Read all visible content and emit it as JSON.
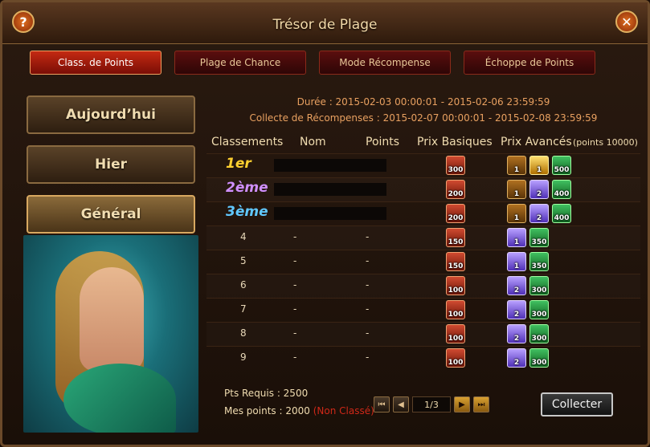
{
  "window": {
    "title": "Trésor de Plage"
  },
  "tabs": [
    {
      "label": "Class. de Points",
      "active": true
    },
    {
      "label": "Plage de Chance",
      "active": false
    },
    {
      "label": "Mode Récompense",
      "active": false
    },
    {
      "label": "Échoppe de Points",
      "active": false
    }
  ],
  "sidebar": {
    "buttons": [
      {
        "label": "Aujourd’hui",
        "active": false
      },
      {
        "label": "Hier",
        "active": false
      },
      {
        "label": "Général",
        "active": true
      }
    ]
  },
  "info": {
    "duration": "Durée : 2015-02-03 00:00:01 - 2015-02-06 23:59:59",
    "collect": "Collecte de Récompenses : 2015-02-07 00:00:01 - 2015-02-08 23:59:59"
  },
  "table": {
    "headers": {
      "rank": "Classements",
      "name": "Nom",
      "points": "Points",
      "basic": "Prix Basiques",
      "advanced": "Prix Avancés",
      "adv_note": "(points 10000)"
    },
    "rows": [
      {
        "rank": "1er",
        "name": "",
        "points": "",
        "basic": "300",
        "adv": [
          {
            "type": "chest",
            "qty": "1"
          },
          {
            "type": "gold",
            "qty": "1"
          },
          {
            "type": "green",
            "qty": "500"
          }
        ]
      },
      {
        "rank": "2ème",
        "name": "",
        "points": "",
        "basic": "200",
        "adv": [
          {
            "type": "chest",
            "qty": "1"
          },
          {
            "type": "purple",
            "qty": "2"
          },
          {
            "type": "green",
            "qty": "400"
          }
        ]
      },
      {
        "rank": "3ème",
        "name": "",
        "points": "",
        "basic": "200",
        "adv": [
          {
            "type": "chest",
            "qty": "1"
          },
          {
            "type": "purple",
            "qty": "2"
          },
          {
            "type": "green",
            "qty": "400"
          }
        ]
      },
      {
        "rank": "4",
        "name": "-",
        "points": "-",
        "basic": "150",
        "adv": [
          {
            "type": "purple",
            "qty": "1"
          },
          {
            "type": "green",
            "qty": "350"
          }
        ]
      },
      {
        "rank": "5",
        "name": "-",
        "points": "-",
        "basic": "150",
        "adv": [
          {
            "type": "purple",
            "qty": "1"
          },
          {
            "type": "green",
            "qty": "350"
          }
        ]
      },
      {
        "rank": "6",
        "name": "-",
        "points": "-",
        "basic": "100",
        "adv": [
          {
            "type": "purple",
            "qty": "2"
          },
          {
            "type": "green",
            "qty": "300"
          }
        ]
      },
      {
        "rank": "7",
        "name": "-",
        "points": "-",
        "basic": "100",
        "adv": [
          {
            "type": "purple",
            "qty": "2"
          },
          {
            "type": "green",
            "qty": "300"
          }
        ]
      },
      {
        "rank": "8",
        "name": "-",
        "points": "-",
        "basic": "100",
        "adv": [
          {
            "type": "purple",
            "qty": "2"
          },
          {
            "type": "green",
            "qty": "300"
          }
        ]
      },
      {
        "rank": "9",
        "name": "-",
        "points": "-",
        "basic": "100",
        "adv": [
          {
            "type": "purple",
            "qty": "2"
          },
          {
            "type": "green",
            "qty": "300"
          }
        ]
      }
    ]
  },
  "footer": {
    "required": "Pts Requis : 2500",
    "mine": "Mes points : 2000",
    "status": "(Non Classé)",
    "page": "1/3",
    "collect_label": "Collecter"
  },
  "icons": {
    "help": "question-mark-icon",
    "close": "close-x-icon"
  }
}
